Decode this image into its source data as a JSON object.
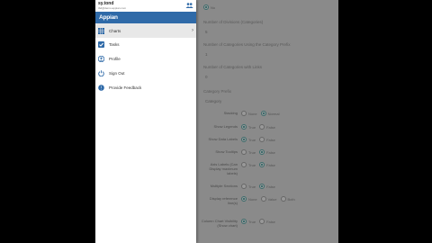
{
  "drawer": {
    "user_name": "sy.tond",
    "user_email": "tbd@demo.appian.com",
    "brand": "Appian",
    "items": [
      {
        "label": "Charts",
        "icon": "grid-icon"
      },
      {
        "label": "Tasks",
        "icon": "checkbox-icon"
      },
      {
        "label": "Profile",
        "icon": "person-icon"
      },
      {
        "label": "Sign Out",
        "icon": "power-icon"
      },
      {
        "label": "Provide Feedback",
        "icon": "feedback-icon"
      }
    ]
  },
  "form": {
    "top_option": "No",
    "num_divisions_label": "Number of Divisions (Categories)",
    "num_divisions_value": "5",
    "num_cat_label": "Number of Categories Using the Category Prefix",
    "num_cat_value": "1",
    "num_cat_links_label": "Number of Categories with Links",
    "num_cat_links_value": "0",
    "prefix_label": "Category Prefix",
    "prefix_placeholder": "Category",
    "fields": [
      {
        "label": "Stacking",
        "options": [
          "None",
          "Normal"
        ],
        "selected": 1
      },
      {
        "label": "Show Legends",
        "options": [
          "True",
          "False"
        ],
        "selected": 0
      },
      {
        "label": "Show Data Labels",
        "options": [
          "True",
          "False"
        ],
        "selected": 0
      },
      {
        "label": "Show Tooltips",
        "options": [
          "True",
          "False"
        ],
        "selected": 1
      },
      {
        "label": "Axis Labels (Can Display maximum labels)",
        "options": [
          "True",
          "False"
        ],
        "selected": 1
      },
      {
        "label": "Multiple Sections",
        "options": [
          "True",
          "False"
        ],
        "selected": 1
      },
      {
        "label": "Display reference line(s)",
        "options": [
          "None",
          "Value",
          "Both"
        ],
        "selected": 0
      },
      {
        "label": "Column Chart Visibility (Show chart)",
        "options": [
          "True",
          "False"
        ],
        "selected": 0
      }
    ]
  }
}
